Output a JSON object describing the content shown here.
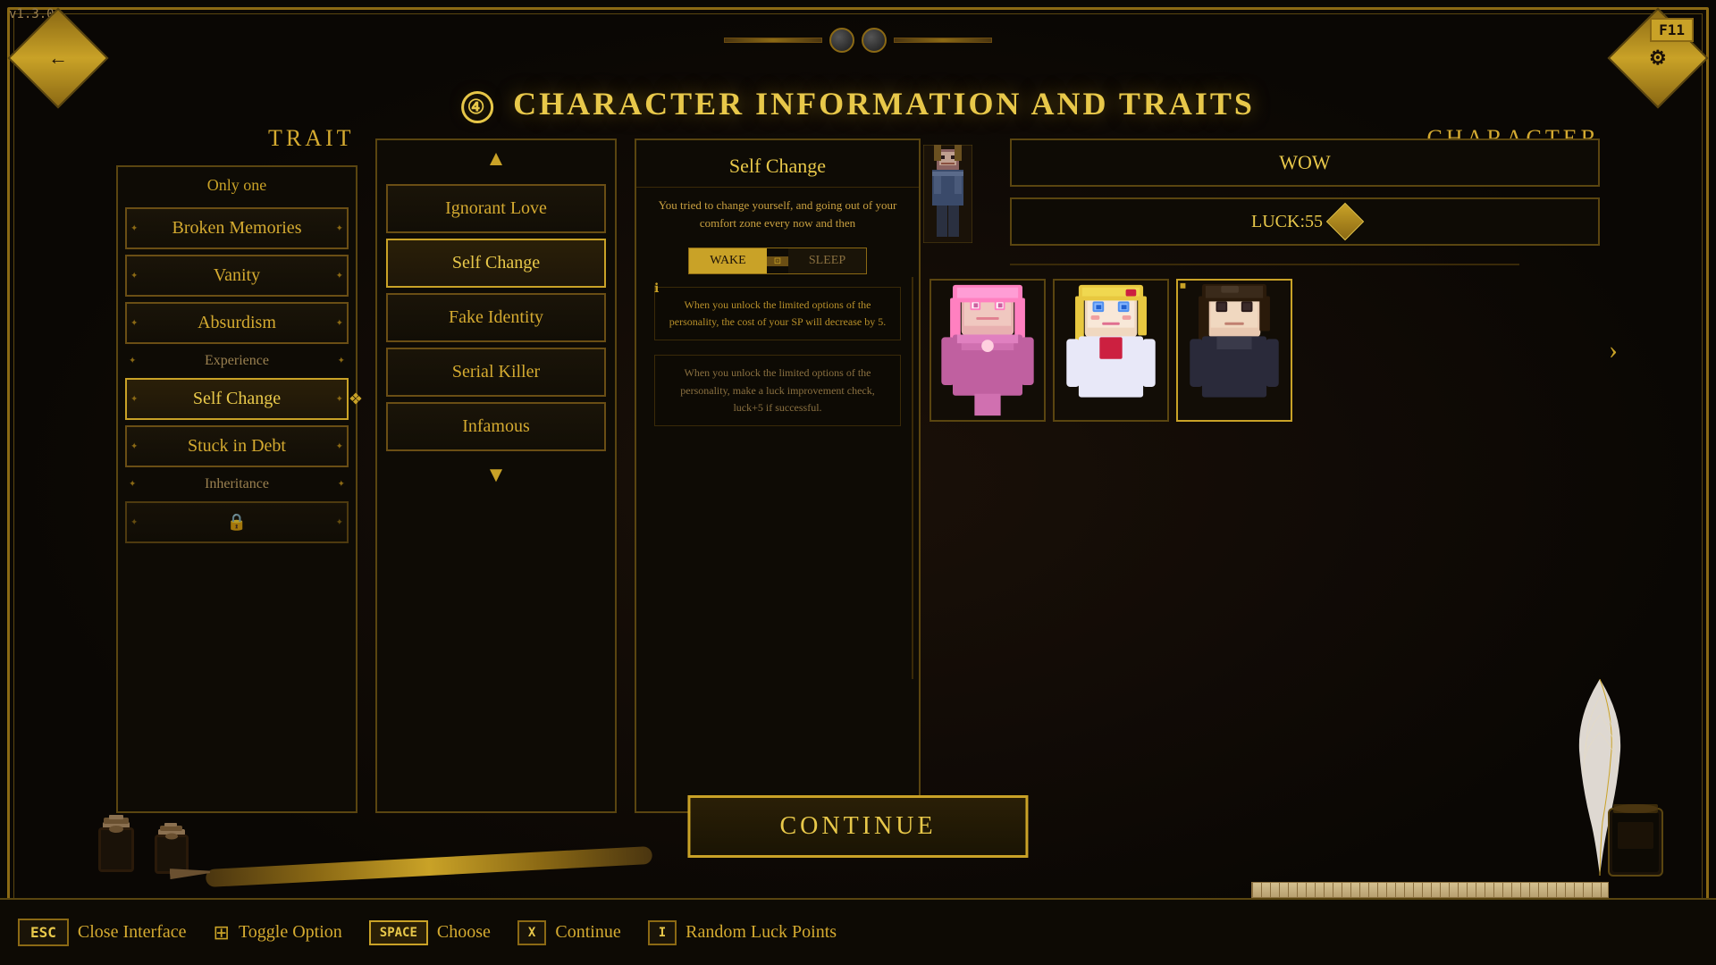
{
  "version": "v1.3.0",
  "page_title": "CHARACTER INFORMATION AND TRAITS",
  "step_number": "④",
  "sections": {
    "trait_label": "TRAIT",
    "character_label": "CHARACTER"
  },
  "left_panel": {
    "only_one": "Only one",
    "items": [
      {
        "id": "broken-memories",
        "label": "Broken Memories",
        "type": "normal"
      },
      {
        "id": "vanity",
        "label": "Vanity",
        "type": "normal"
      },
      {
        "id": "absurdism",
        "label": "Absurdism",
        "type": "normal"
      },
      {
        "id": "experience",
        "label": "Experience",
        "type": "category"
      },
      {
        "id": "self-change",
        "label": "Self Change",
        "type": "selected"
      },
      {
        "id": "stuck-in-debt",
        "label": "Stuck in Debt",
        "type": "normal"
      },
      {
        "id": "inheritance",
        "label": "Inheritance",
        "type": "category"
      },
      {
        "id": "locked",
        "label": "🔒",
        "type": "locked"
      }
    ]
  },
  "middle_panel": {
    "items": [
      {
        "id": "ignorant-love",
        "label": "Ignorant Love",
        "selected": false
      },
      {
        "id": "self-change-opt",
        "label": "Self Change",
        "selected": true
      },
      {
        "id": "fake-identity",
        "label": "Fake Identity",
        "selected": false
      },
      {
        "id": "serial-killer",
        "label": "Serial Killer",
        "selected": false
      },
      {
        "id": "infamous",
        "label": "Infamous",
        "selected": false
      }
    ]
  },
  "detail_panel": {
    "title": "Self Change",
    "description": "You tried to change yourself, and going out of your comfort zone every now and then",
    "toggle": {
      "wake_label": "WAKE",
      "sleep_label": "SLEEP",
      "active": "wake"
    },
    "effects": [
      {
        "text": "When you unlock the limited options of the personality, the cost of your SP will decrease by 5."
      },
      {
        "text": "When you unlock the limited options of the personality, make a luck improvement check, luck+5 if successful."
      }
    ]
  },
  "character_panel": {
    "name": "WOW",
    "luck_label": "LUCK:55",
    "portraits": [
      {
        "id": "pink-char",
        "label": "Pink character"
      },
      {
        "id": "blonde-char",
        "label": "Blonde character"
      },
      {
        "id": "dark-hair-char",
        "label": "Dark hair character",
        "selected": true
      }
    ]
  },
  "continue_button": "CONTINUE",
  "toolbar": {
    "items": [
      {
        "key": "ESC",
        "label": "Close Interface",
        "type": "key"
      },
      {
        "icon": "⊕",
        "label": "Toggle Option",
        "type": "icon"
      },
      {
        "key": "SPACE",
        "label": "Choose",
        "type": "key-highlight"
      },
      {
        "key": "X",
        "label": "Continue",
        "type": "key"
      },
      {
        "key": "I",
        "label": "Random Luck Points",
        "type": "key"
      }
    ]
  }
}
